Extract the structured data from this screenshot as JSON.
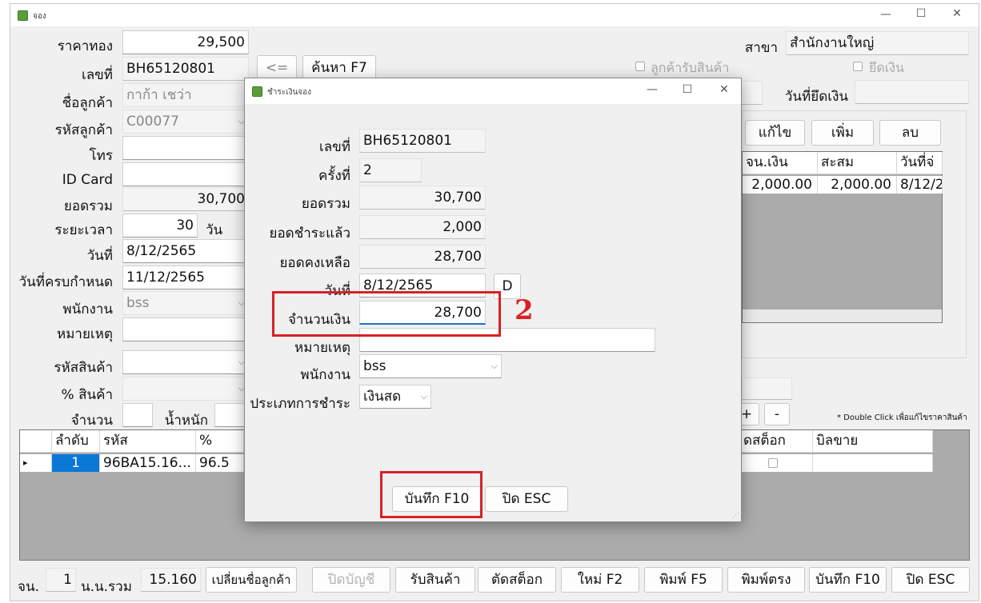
{
  "window": {
    "title": "จอง"
  },
  "form": {
    "gold_price_label": "ราคาทอง",
    "gold_price": "29,500",
    "doc_no_label": "เลขที่",
    "doc_no": "BH65120801",
    "back_btn": "<=",
    "search_btn": "ค้นหา F7",
    "branch_label": "สาขา",
    "branch": "สำนักงานใหญ่",
    "cust_receive_label": "ลูกค้ารับสินค้า",
    "seize_label": "ยึดเงิน",
    "cust_name_label": "ชื่อลูกค้า",
    "cust_name": "กาก้า เชว่า",
    "seize_date_label": "วันที่ยึดเงิน",
    "cust_code_label": "รหัสลูกค้า",
    "cust_code": "C00077",
    "phone_label": "โทร",
    "idcard_label": "ID Card",
    "total_label": "ยอดรวม",
    "total": "30,700",
    "period_label": "ระยะเวลา",
    "period": "30",
    "period_unit": "วัน",
    "date_label": "วันที่",
    "date": "8/12/2565",
    "due_label": "วันที่ครบกำหนด",
    "due": "11/12/2565",
    "staff_label": "พนักงาน",
    "staff": "bss",
    "remark_label": "หมายเหตุ",
    "product_code_label": "รหัสสินค้า",
    "percent_label": "% สินค้า",
    "qty_label": "จำนวน",
    "weight_label": "น้ำหนัก"
  },
  "right": {
    "edit_btn": "แก้ไข",
    "add_btn": "เพิ่ม",
    "delete_btn": "ลบ",
    "pay_headers": [
      "จน.เงิน",
      "สะสม",
      "วันที่จ่"
    ],
    "pay_rows": [
      [
        "2,000.00",
        "2,000.00",
        "8/12/2"
      ]
    ],
    "plus_btn": "+",
    "minus_btn": "-",
    "note": "* Double Click เพื่อแก้ไขราคาสินค้า"
  },
  "items": {
    "headers": [
      "ลำดับ",
      "รหัส",
      "%"
    ],
    "right_headers": [
      "ดสต็อก",
      "บิลขาย"
    ],
    "rows": [
      {
        "seq": "1",
        "code": "96BA15.16...",
        "pct": "96.5"
      }
    ]
  },
  "footer": {
    "count_label": "จน.",
    "count": "1",
    "weight_label": "น.น.รวม",
    "weight": "15.160",
    "buttons": [
      "เปลี่ยนชื่อลูกค้า",
      "ปิดบัญชี",
      "รับสินค้า",
      "ตัดสต็อก",
      "ใหม่ F2",
      "พิมพ์ F5",
      "พิมพ์ตรง",
      "บันทึก F10",
      "ปิด ESC"
    ]
  },
  "dialog": {
    "title": "ชำระเงินจอง",
    "doc_no_label": "เลขที่",
    "doc_no": "BH65120801",
    "times_label": "ครั้งที่",
    "times": "2",
    "total_label": "ยอดรวม",
    "total": "30,700",
    "paid_label": "ยอดชำระแล้ว",
    "paid": "2,000",
    "remain_label": "ยอดคงเหลือ",
    "remain": "28,700",
    "date_label": "วันที่",
    "date": "8/12/2565",
    "date_btn": "D",
    "amount_label": "จำนวนเงิน",
    "amount": "28,700",
    "remark_label": "หมายเหตุ",
    "staff_label": "พนักงาน",
    "staff": "bss",
    "pay_type_label": "ประเภทการชำระ",
    "pay_type": "เงินสด",
    "save_btn": "บันทึก F10",
    "close_btn": "ปิด ESC"
  },
  "annotation": {
    "step": "2",
    "color": "#d92027"
  }
}
